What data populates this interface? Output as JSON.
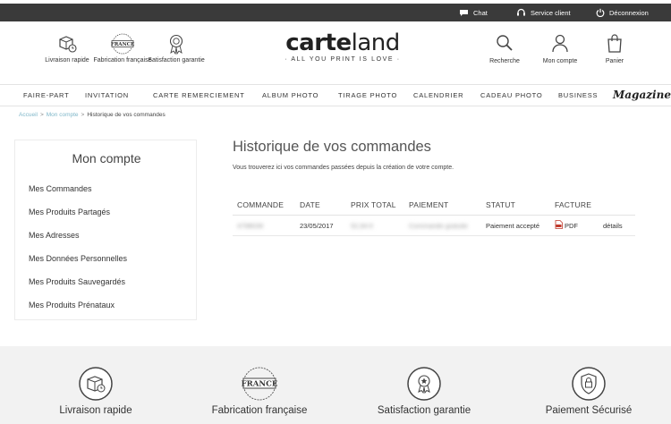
{
  "topbar": {
    "chat": "Chat",
    "service": "Service client",
    "logout": "Déconnexion"
  },
  "features": [
    {
      "label": "Livraison rapide",
      "icon": "box-clock-icon"
    },
    {
      "label": "Fabrication française",
      "icon": "france-seal-icon"
    },
    {
      "label": "Satisfaction garantie",
      "icon": "award-ribbon-icon"
    }
  ],
  "logo": {
    "name_bold": "carte",
    "name_light": "land",
    "tagline": "· ALL YOU PRINT IS LOVE ·"
  },
  "header_buttons": {
    "search": "Recherche",
    "account": "Mon compte",
    "cart": "Panier"
  },
  "nav": {
    "items": [
      "FAIRE-PART",
      "INVITATION",
      "CARTE REMERCIEMENT",
      "ALBUM PHOTO",
      "TIRAGE PHOTO",
      "CALENDRIER",
      "CADEAU PHOTO",
      "BUSINESS"
    ],
    "magazine": "Magazine"
  },
  "breadcrumb": {
    "home": "Accueil",
    "account": "Mon compte",
    "current": "Historique de vos commandes",
    "separator": ">"
  },
  "sidebar": {
    "title": "Mon compte",
    "items": [
      "Mes Commandes",
      "Mes Produits Partagés",
      "Mes Adresses",
      "Mes Données Personnelles",
      "Mes Produits Sauvegardés",
      "Mes Produits Prénataux"
    ]
  },
  "main": {
    "title": "Historique de vos commandes",
    "intro": "Vous trouverez ici vos commandes passées depuis la création de votre compte.",
    "columns": [
      "COMMANDE",
      "DATE",
      "PRIX TOTAL",
      "PAIEMENT",
      "STATUT",
      "FACTURE"
    ],
    "rows": [
      {
        "order": "4798039",
        "date": "23/05/2017",
        "total": "52,94 €",
        "payment": "Commande gratuite",
        "status": "Paiement accepté",
        "invoice": "PDF",
        "details": "détails"
      }
    ]
  },
  "footer": {
    "items": [
      {
        "label": "Livraison rapide",
        "icon": "box-clock-icon"
      },
      {
        "label": "Fabrication française",
        "icon": "france-seal-icon"
      },
      {
        "label": "Satisfaction garantie",
        "icon": "award-ribbon-icon"
      },
      {
        "label": "Paiement Sécurisé",
        "icon": "secure-payment-shield-icon"
      }
    ]
  },
  "colors": {
    "topbar": "#3a3a3a",
    "breadcrumb_link": "#7fb7c9",
    "footer_bg": "#f2f2f2",
    "pdf_red": "#c0392b"
  }
}
